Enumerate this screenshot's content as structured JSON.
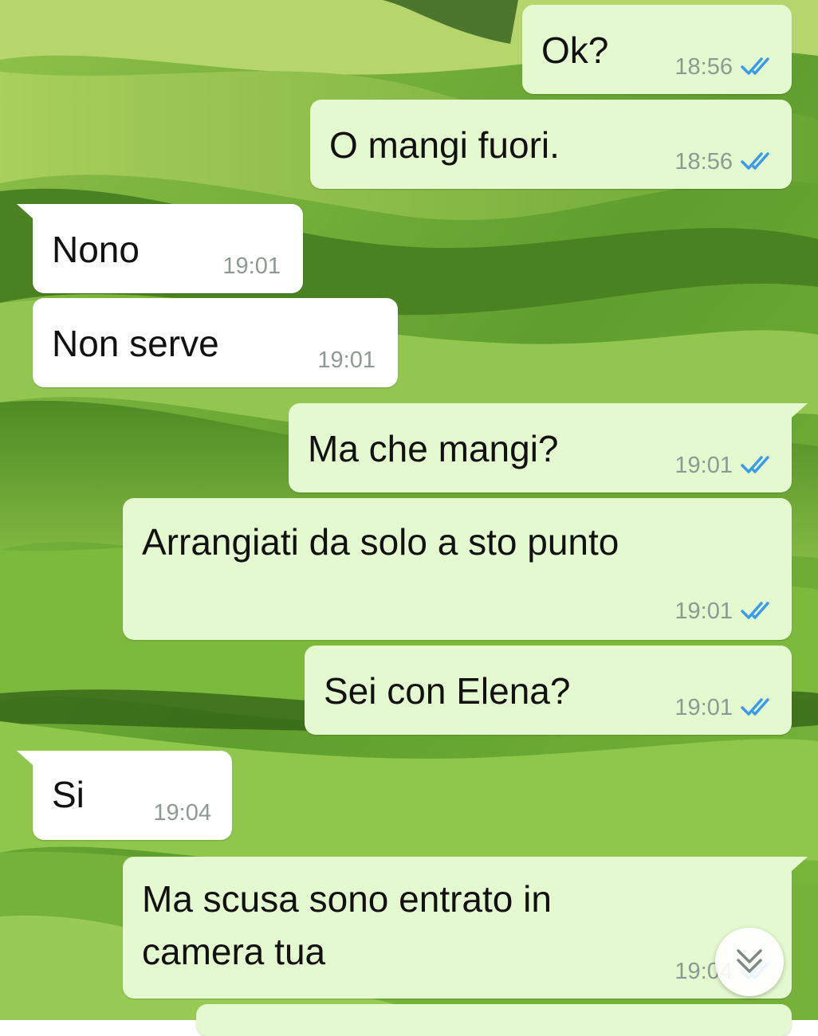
{
  "colors": {
    "outgoing_bubble": "#e4f9cf",
    "incoming_bubble": "#ffffff",
    "read_ticks": "#3a9be8",
    "timestamp": "#8d9a91",
    "message_text": "#111111"
  },
  "messages": [
    {
      "direction": "outgoing",
      "text": "Ok?",
      "time": "18:56",
      "status": "read"
    },
    {
      "direction": "outgoing",
      "text": "O mangi fuori.",
      "time": "18:56",
      "status": "read"
    },
    {
      "direction": "incoming",
      "text": "Nono",
      "time": "19:01"
    },
    {
      "direction": "incoming",
      "text": "Non serve",
      "time": "19:01"
    },
    {
      "direction": "outgoing",
      "text": "Ma che mangi?",
      "time": "19:01",
      "status": "read"
    },
    {
      "direction": "outgoing",
      "text": "Arrangiati da solo a sto punto",
      "time": "19:01",
      "status": "read"
    },
    {
      "direction": "outgoing",
      "text": "Sei con Elena?",
      "time": "19:01",
      "status": "read"
    },
    {
      "direction": "incoming",
      "text": "Si",
      "time": "19:04"
    },
    {
      "direction": "outgoing",
      "text": "Ma scusa sono entrato in",
      "text_line2": "camera tua",
      "time": "19:04",
      "status": "read"
    }
  ],
  "scroll_button": {
    "icon": "double-chevron-down-icon"
  }
}
